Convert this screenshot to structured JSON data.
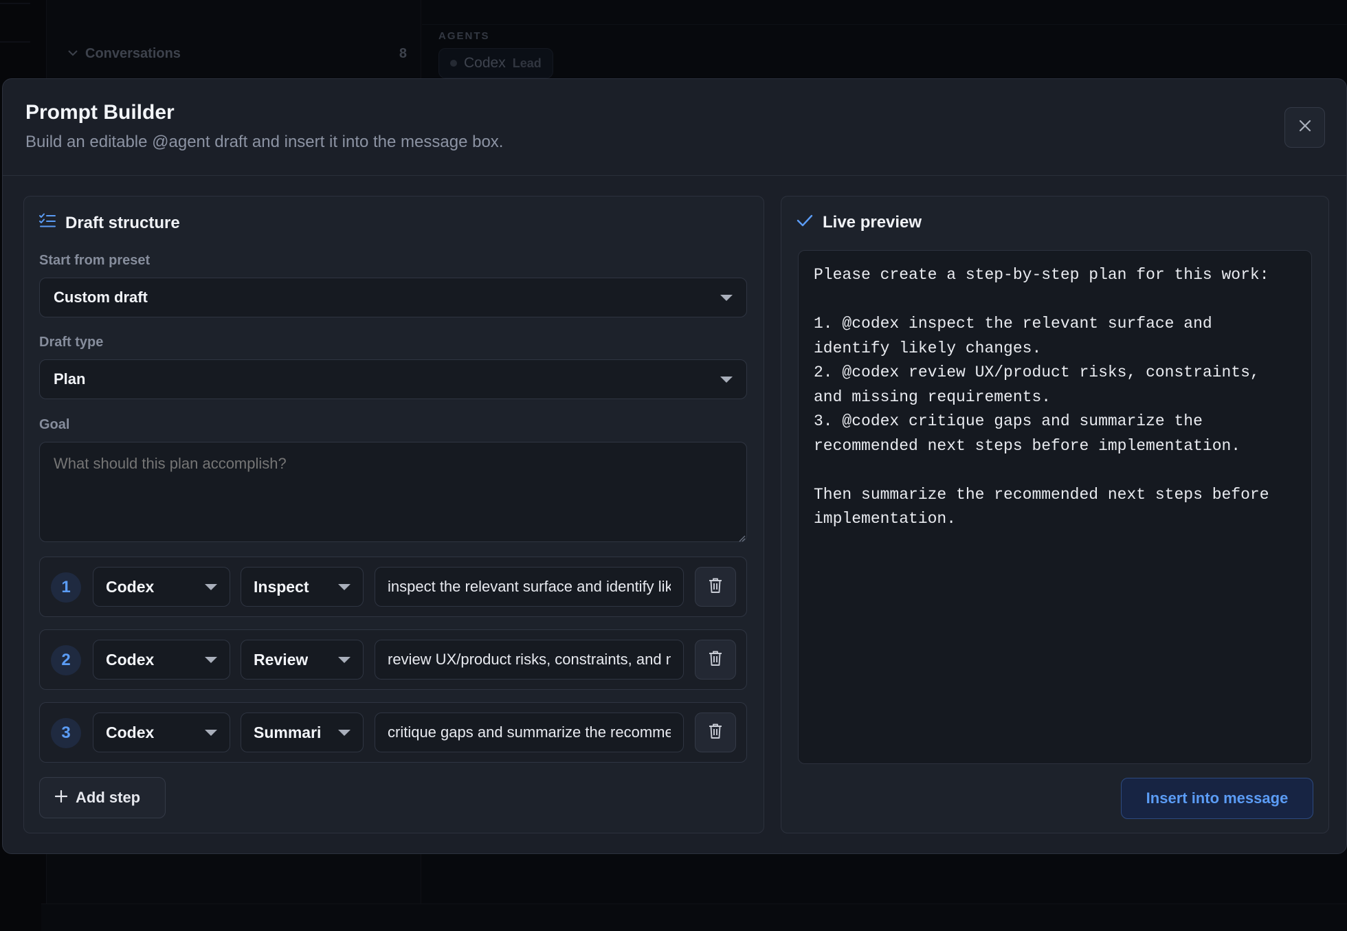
{
  "background": {
    "sidebar": {
      "section_label": "Conversations",
      "section_count": "8"
    },
    "main": {
      "agents_label": "AGENTS",
      "agent_chip": {
        "name": "Codex",
        "role": "Lead"
      }
    }
  },
  "modal": {
    "title": "Prompt Builder",
    "subtitle": "Build an editable @agent draft and insert it into the message box.",
    "close_icon": "close-icon"
  },
  "draft_structure": {
    "heading": "Draft structure",
    "heading_icon": "checklist-icon",
    "preset_label": "Start from preset",
    "preset_value": "Custom draft",
    "type_label": "Draft type",
    "type_value": "Plan",
    "goal_label": "Goal",
    "goal_value": "",
    "goal_placeholder": "What should this plan accomplish?",
    "steps": [
      {
        "number": "1",
        "agent": "Codex",
        "action": "Inspect",
        "text": "inspect the relevant surface and identify likely changes."
      },
      {
        "number": "2",
        "agent": "Codex",
        "action": "Review",
        "text": "review UX/product risks, constraints, and missing requirements."
      },
      {
        "number": "3",
        "agent": "Codex",
        "action": "Summari",
        "text": "critique gaps and summarize the recommended next steps before implementation."
      }
    ],
    "add_step_label": "Add step"
  },
  "live_preview": {
    "heading": "Live preview",
    "heading_icon": "check-icon",
    "text": "Please create a step-by-step plan for this work:\n\n1. @codex inspect the relevant surface and\nidentify likely changes.\n2. @codex review UX/product risks, constraints,\nand missing requirements.\n3. @codex critique gaps and summarize the\nrecommended next steps before implementation.\n\nThen summarize the recommended next steps before\nimplementation.",
    "insert_label": "Insert into message"
  },
  "colors": {
    "accent": "#5b9cf5",
    "panel": "#1d222b",
    "modal": "#1b1f28",
    "input": "#161a21"
  }
}
